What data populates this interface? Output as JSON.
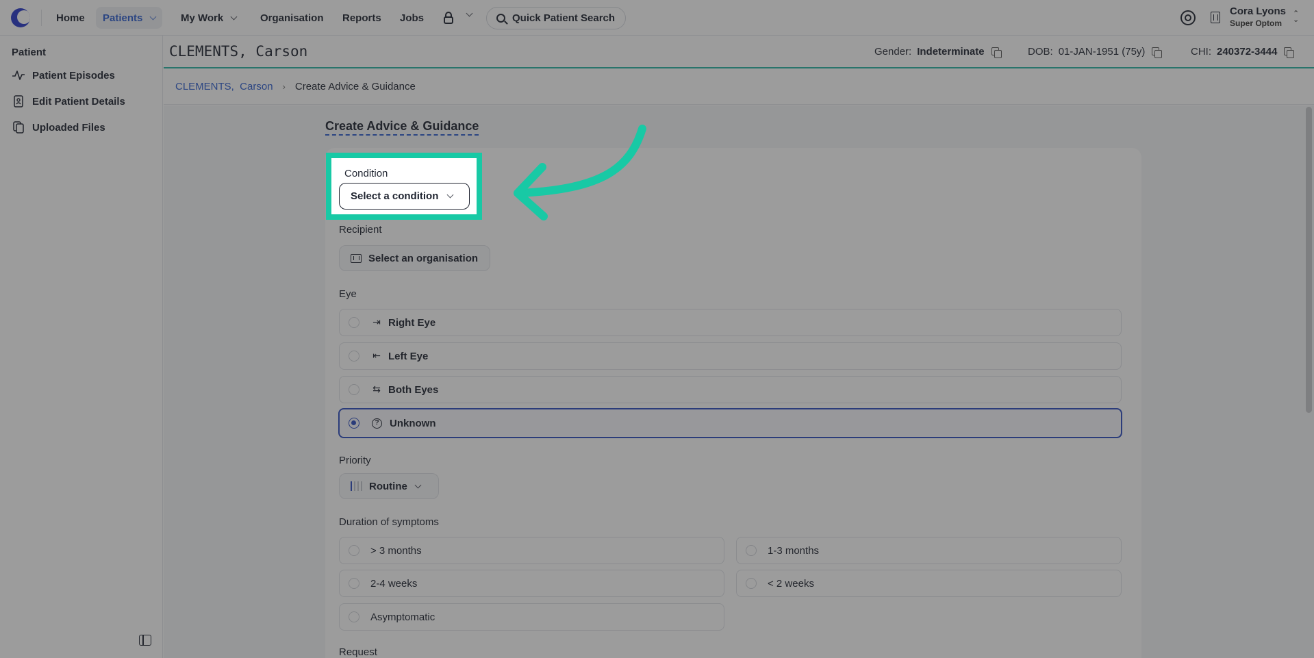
{
  "nav": {
    "home": "Home",
    "patients": "Patients",
    "my_work": "My Work",
    "organisation": "Organisation",
    "reports": "Reports",
    "jobs": "Jobs",
    "search": "Quick Patient Search"
  },
  "user": {
    "name": "Cora Lyons",
    "role": "Super Optom"
  },
  "sidebar": {
    "title": "Patient",
    "items": [
      {
        "label": "Patient Episodes",
        "icon": "pulse-icon"
      },
      {
        "label": "Edit Patient Details",
        "icon": "person-card-icon"
      },
      {
        "label": "Uploaded Files",
        "icon": "files-icon"
      }
    ]
  },
  "patient": {
    "name": "CLEMENTS, Carson",
    "gender_label": "Gender:",
    "gender": "Indeterminate",
    "dob_label": "DOB:",
    "dob": "01-JAN-1951 (75y)",
    "chi_label": "CHI:",
    "chi": "240372-3444"
  },
  "breadcrumb": {
    "patient": "CLEMENTS,  Carson",
    "current": "Create Advice & Guidance"
  },
  "form": {
    "title": "Create Advice & Guidance",
    "condition_label": "Condition",
    "condition_button": "Select a condition",
    "recipient_label": "Recipient",
    "recipient_button": "Select an organisation",
    "eye_label": "Eye",
    "eye_options": [
      {
        "label": "Right Eye",
        "icon": "arrow-right-to-line-icon",
        "selected": false
      },
      {
        "label": "Left Eye",
        "icon": "arrow-left-to-line-icon",
        "selected": false
      },
      {
        "label": "Both Eyes",
        "icon": "swap-arrows-icon",
        "selected": false
      },
      {
        "label": "Unknown",
        "icon": "question-circle-icon",
        "selected": true
      }
    ],
    "priority_label": "Priority",
    "priority_value": "Routine",
    "duration_label": "Duration of symptoms",
    "duration_options": [
      "> 3 months",
      "1-3 months",
      "2-4 weeks",
      "< 2 weeks",
      "Asymptomatic"
    ],
    "request_label": "Request"
  },
  "colors": {
    "accent": "#2f5fd0",
    "highlight": "#18c9a5",
    "teal_rule": "#2bb5a4"
  }
}
